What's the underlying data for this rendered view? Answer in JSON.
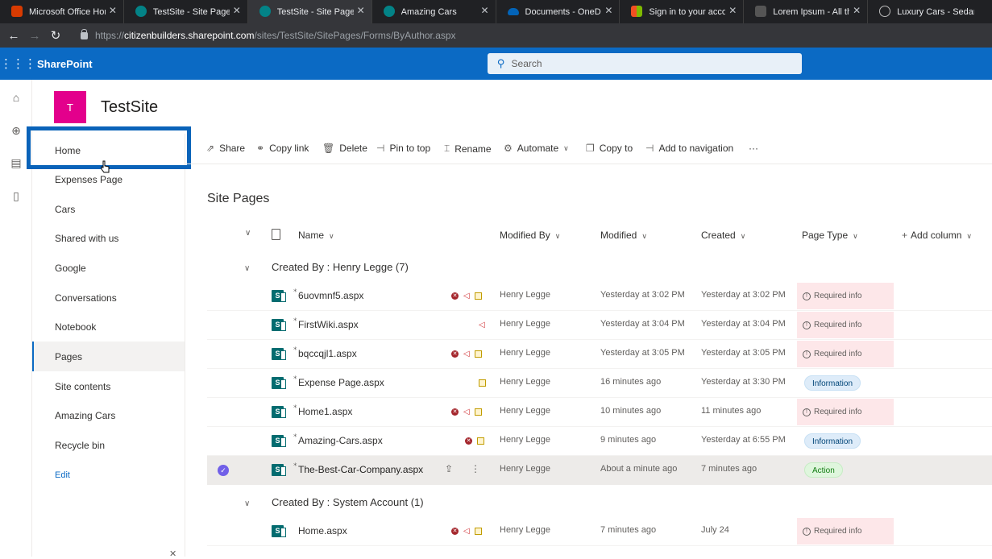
{
  "browser": {
    "tabs": [
      {
        "label": "Microsoft Office Home",
        "icon": "office-icon",
        "color": "#d83b01",
        "active": false
      },
      {
        "label": "TestSite - Site Pages - M",
        "icon": "sharepoint-icon",
        "color": "#038387",
        "active": false
      },
      {
        "label": "TestSite - Site Pages - M",
        "icon": "sharepoint-icon",
        "color": "#038387",
        "active": true
      },
      {
        "label": "Amazing Cars",
        "icon": "sharepoint-icon",
        "color": "#038387",
        "active": false
      },
      {
        "label": "Documents - OneDrive",
        "icon": "onedrive-icon",
        "color": "#0364b8",
        "active": false
      },
      {
        "label": "Sign in to your account",
        "icon": "microsoft-icon",
        "color": "#f25022",
        "active": false
      },
      {
        "label": "Lorem Ipsum - All the fa",
        "icon": "lorem-icon",
        "color": "#555555",
        "active": false
      },
      {
        "label": "Luxury Cars - Sedans, S",
        "icon": "car-brand-icon",
        "color": "#888888",
        "active": false
      }
    ],
    "url_prefix": "https://",
    "url_host": "citizenbuilders.sharepoint.com",
    "url_path": "/sites/TestSite/SitePages/Forms/ByAuthor.aspx"
  },
  "suite": {
    "brand": "SharePoint",
    "search_placeholder": "Search"
  },
  "site": {
    "logo_letter": "T",
    "title": "TestSite"
  },
  "nav": {
    "items": [
      "Home",
      "Expenses Page",
      "Cars",
      "Shared with us",
      "Google",
      "Conversations",
      "Notebook",
      "Pages",
      "Site contents",
      "Amazing Cars",
      "Recycle bin"
    ],
    "selected": "Pages",
    "edit": "Edit"
  },
  "commands": {
    "share": "Share",
    "copy_link": "Copy link",
    "delete": "Delete",
    "pin": "Pin to top",
    "rename": "Rename",
    "automate": "Automate",
    "copy_to": "Copy to",
    "add_nav": "Add to navigation",
    "more": "···"
  },
  "list": {
    "title": "Site Pages",
    "columns": {
      "name": "Name",
      "modified_by": "Modified By",
      "modified": "Modified",
      "created": "Created",
      "page_type": "Page Type",
      "add_column": "Add column"
    },
    "groups": [
      {
        "label": "Created By : Henry Legge (7)"
      },
      {
        "label": "Created By : System Account (1)"
      }
    ],
    "rows": [
      {
        "name": "6uovmnf5.aspx",
        "modified_by": "Henry Legge",
        "modified": "Yesterday at 3:02 PM",
        "created": "Yesterday at 3:02 PM",
        "page_type": "Required info"
      },
      {
        "name": "FirstWiki.aspx",
        "modified_by": "Henry Legge",
        "modified": "Yesterday at 3:04 PM",
        "created": "Yesterday at 3:04 PM",
        "page_type": "Required info"
      },
      {
        "name": "bqccqjl1.aspx",
        "modified_by": "Henry Legge",
        "modified": "Yesterday at 3:05 PM",
        "created": "Yesterday at 3:05 PM",
        "page_type": "Required info"
      },
      {
        "name": "Expense Page.aspx",
        "modified_by": "Henry Legge",
        "modified": "16 minutes ago",
        "created": "Yesterday at 3:30 PM",
        "page_type": "Information"
      },
      {
        "name": "Home1.aspx",
        "modified_by": "Henry Legge",
        "modified": "10 minutes ago",
        "created": "11 minutes ago",
        "page_type": "Required info"
      },
      {
        "name": "Amazing-Cars.aspx",
        "modified_by": "Henry Legge",
        "modified": "9 minutes ago",
        "created": "Yesterday at 6:55 PM",
        "page_type": "Information"
      },
      {
        "name": "The-Best-Car-Company.aspx",
        "modified_by": "Henry Legge",
        "modified": "About a minute ago",
        "created": "7 minutes ago",
        "page_type": "Action"
      },
      {
        "name": "Home.aspx",
        "modified_by": "Henry Legge",
        "modified": "7 minutes ago",
        "created": "July 24",
        "page_type": "Required info"
      }
    ]
  },
  "colors": {
    "suite_bar": "#0b6ac4",
    "site_logo": "#e3008c",
    "required_bg": "#fde7e9",
    "info_bg": "#deecf9",
    "action_bg": "#dff6dd"
  }
}
